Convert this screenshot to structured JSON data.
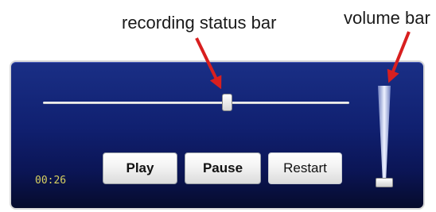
{
  "annotations": {
    "recording_status_bar": "recording status bar",
    "volume_bar": "volume bar"
  },
  "player": {
    "elapsed_time": "00:26",
    "recording_progress": 0.6,
    "volume_level": 0.0,
    "buttons": {
      "play": "Play",
      "pause": "Pause",
      "restart": "Restart"
    }
  },
  "colors": {
    "panel_top": "#1a2f86",
    "panel_bottom": "#060b2c",
    "time_text": "#d8d060",
    "arrow": "#d81f1f"
  },
  "icons": {
    "annotation_arrow": "arrow-icon"
  }
}
